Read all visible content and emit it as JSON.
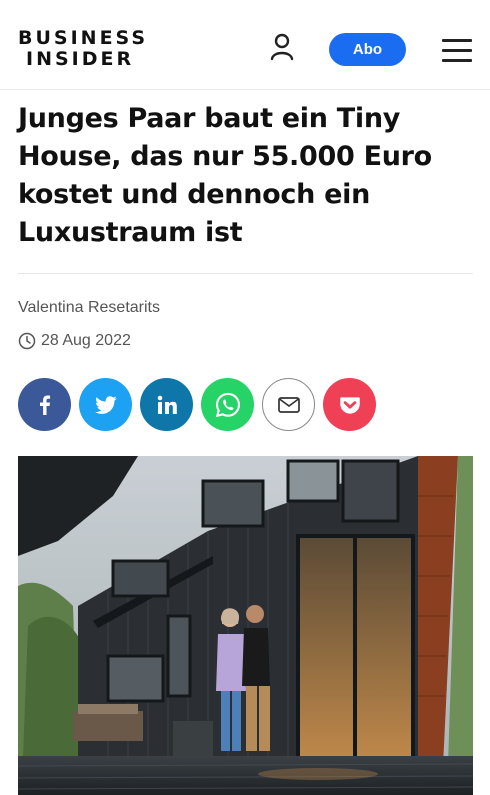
{
  "header": {
    "logo_line1": "BUSINESS",
    "logo_line2": "INSIDER",
    "abo_label": "Abo",
    "user_icon": "user-icon",
    "menu_icon": "hamburger-icon",
    "accent_color": "#1a6cf0"
  },
  "article": {
    "headline": "Junges Paar baut ein Tiny House, das nur 55.000 Euro kostet und dennoch ein Luxustraum ist",
    "author": "Valentina Resetarits",
    "date": "28 Aug 2022",
    "clock_icon": "clock-icon"
  },
  "share": [
    {
      "name": "facebook",
      "icon": "facebook-icon",
      "color": "#3b5998"
    },
    {
      "name": "twitter",
      "icon": "twitter-icon",
      "color": "#1da1f2"
    },
    {
      "name": "linkedin",
      "icon": "linkedin-icon",
      "color": "#0e76a8"
    },
    {
      "name": "whatsapp",
      "icon": "whatsapp-icon",
      "color": "#25d366"
    },
    {
      "name": "email",
      "icon": "mail-icon",
      "color": "#ffffff"
    },
    {
      "name": "pocket",
      "icon": "pocket-icon",
      "color": "#ef4056"
    }
  ]
}
